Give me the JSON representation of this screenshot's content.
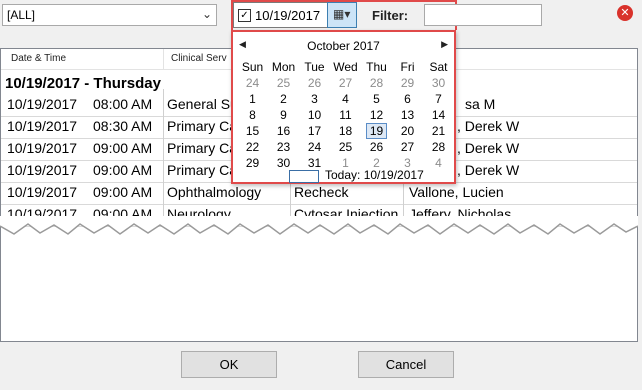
{
  "top": {
    "combo_value": "[ALL]",
    "date_value": "10/19/2017",
    "date_checked": true,
    "filter_label": "Filter:",
    "filter_value": ""
  },
  "list": {
    "headers": [
      "Date & Time",
      "Clinical Serv"
    ],
    "group_label": "10/19/2017 - Thursday",
    "rows": [
      {
        "date": "10/19/2017",
        "time": "08:00 AM",
        "service": "General Su",
        "type": "",
        "provider": "sa M"
      },
      {
        "date": "10/19/2017",
        "time": "08:30 AM",
        "service": "Primary Ca",
        "type": "",
        "provider": ", Derek W"
      },
      {
        "date": "10/19/2017",
        "time": "09:00 AM",
        "service": "Primary Ca",
        "type": "",
        "provider": ", Derek W"
      },
      {
        "date": "10/19/2017",
        "time": "09:00 AM",
        "service": "Primary Ca",
        "type": "",
        "provider": ", Derek W"
      },
      {
        "date": "10/19/2017",
        "time": "09:00 AM",
        "service": "Ophthalmology",
        "type": "Recheck",
        "provider": "Vallone, Lucien"
      },
      {
        "date": "10/19/2017",
        "time": "09:00 AM",
        "service": "Neurology",
        "type": "Cytosar Injection",
        "provider": "Jeffery, Nicholas"
      }
    ]
  },
  "calendar": {
    "month_label": "October 2017",
    "weekdays": [
      "Sun",
      "Mon",
      "Tue",
      "Wed",
      "Thu",
      "Fri",
      "Sat"
    ],
    "weeks": [
      [
        "24",
        "25",
        "26",
        "27",
        "28",
        "29",
        "30"
      ],
      [
        "1",
        "2",
        "3",
        "4",
        "5",
        "6",
        "7"
      ],
      [
        "8",
        "9",
        "10",
        "11",
        "12",
        "13",
        "14"
      ],
      [
        "15",
        "16",
        "17",
        "18",
        "19",
        "20",
        "21"
      ],
      [
        "22",
        "23",
        "24",
        "25",
        "26",
        "27",
        "28"
      ],
      [
        "29",
        "30",
        "31",
        "1",
        "2",
        "3",
        "4"
      ]
    ],
    "today_label": "Today: 10/19/2017"
  },
  "buttons": {
    "ok": "OK",
    "cancel": "Cancel"
  },
  "colors": {
    "highlight_border": "#e04a4a",
    "selected_day_bg": "#dde8f5",
    "close_button": "#d9322b"
  },
  "icons": {
    "combo_arrow": "chevron-down-icon",
    "calendar_button": "calendar-icon",
    "close": "close-icon",
    "prev_month": "chevron-left-icon",
    "next_month": "chevron-right-icon"
  }
}
